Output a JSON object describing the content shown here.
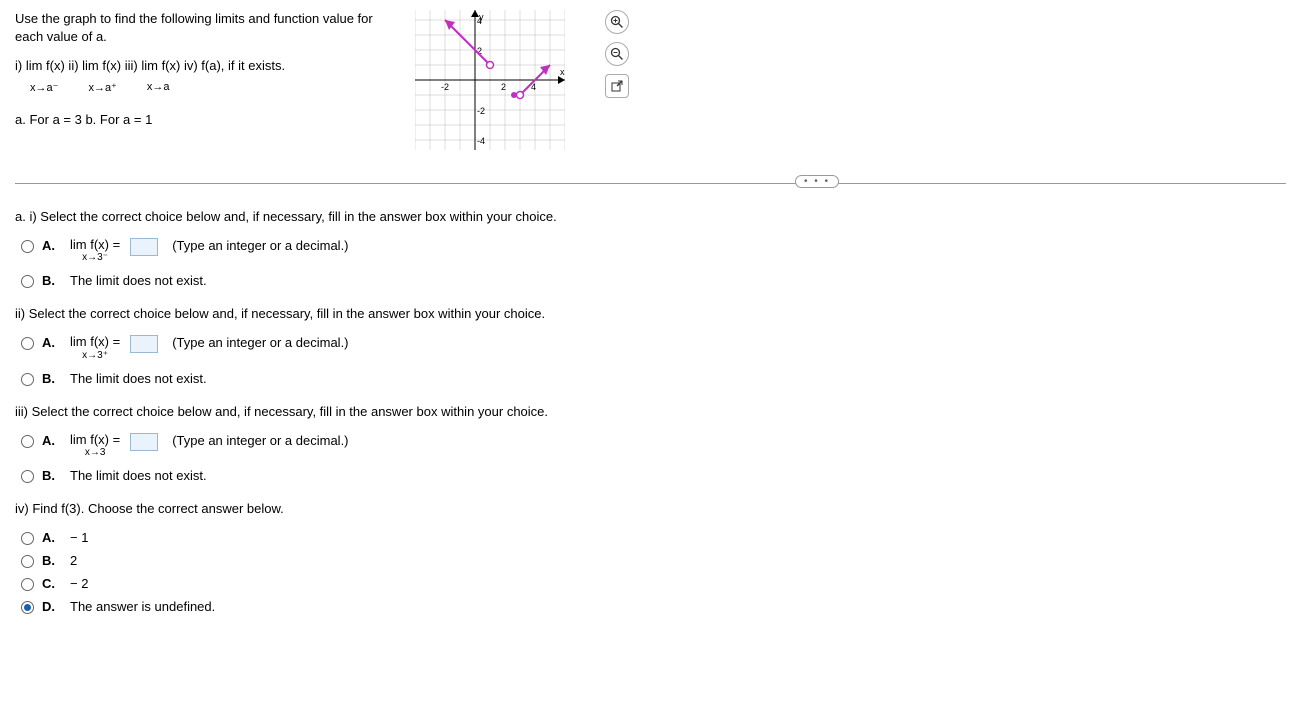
{
  "intro": "Use the graph to find the following limits and function value for each value of a.",
  "parts_line": "i)  lim  f(x)  ii)   lim  f(x)  iii)   lim  f(x)  iv)  f(a), if it exists.",
  "approach": {
    "a": "x→a⁻",
    "b": "x→a⁺",
    "c": "x→a"
  },
  "sub": "a. For a = 3 b. For a = 1",
  "tools": {
    "zoom_in": "zoom-in",
    "zoom_out": "zoom-out",
    "popout": "popout"
  },
  "more": "• • •",
  "sections": {
    "ai": "a. i) Select the correct choice below and, if necessary, fill in the answer box within your choice.",
    "aii": "ii) Select the correct choice below and, if necessary, fill in the answer box within your choice.",
    "aiii": "iii) Select the correct choice below and, if necessary, fill in the answer box within your choice.",
    "aiv": "iv) Find f(3). Choose the correct answer below."
  },
  "choice_labels": {
    "A": "A.",
    "B": "B.",
    "C": "C.",
    "D": "D."
  },
  "lim": {
    "prefix_top": "lim  f(x) =",
    "sub3m": "x→3⁻",
    "sub3p": "x→3⁺",
    "sub3": "x→3"
  },
  "hint": "(Type an integer or a decimal.)",
  "dne": "The limit does not exist.",
  "iv_choices": {
    "a": "− 1",
    "b": "2",
    "c": "− 2",
    "d": "The answer is undefined."
  },
  "chart_data": {
    "type": "line",
    "title": "",
    "xlabel": "x",
    "ylabel": "y",
    "xlim": [
      -4,
      6
    ],
    "ylim": [
      -4,
      4
    ],
    "ticks_x": [
      -2,
      2,
      4
    ],
    "ticks_y": [
      -4,
      -2,
      2,
      4
    ],
    "series": [
      {
        "name": "segment1",
        "points": [
          [
            -2,
            4
          ],
          [
            1,
            1
          ]
        ],
        "end_open": [
          false,
          true
        ],
        "color": "#c030c0"
      },
      {
        "name": "segment2",
        "points": [
          [
            3,
            -1
          ],
          [
            5,
            1
          ]
        ],
        "end_open": [
          true,
          false
        ],
        "color": "#c030c0"
      }
    ],
    "points": [
      {
        "x": 3,
        "y": -1,
        "open": true
      },
      {
        "x": 1,
        "y": 1,
        "open": true
      },
      {
        "x": 3,
        "y": -1,
        "filled_neighbor_x": 2.6,
        "filled_neighbor_y": -1
      }
    ]
  }
}
